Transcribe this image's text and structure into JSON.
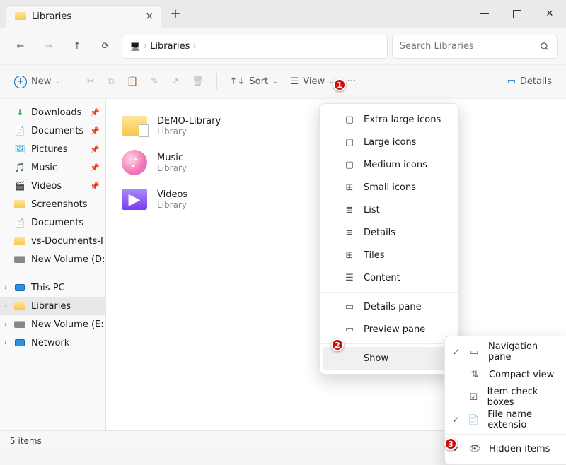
{
  "window": {
    "tab_title": "Libraries",
    "search_placeholder": "Search Libraries"
  },
  "breadcrumb": [
    "Libraries"
  ],
  "toolbar": {
    "new_label": "New",
    "sort_label": "Sort",
    "view_label": "View",
    "details_label": "Details"
  },
  "sidebar": {
    "quick": [
      {
        "label": "Downloads",
        "icon": "download",
        "pin": true
      },
      {
        "label": "Documents",
        "icon": "doc",
        "pin": true
      },
      {
        "label": "Pictures",
        "icon": "pic",
        "pin": true
      },
      {
        "label": "Music",
        "icon": "music",
        "pin": true
      },
      {
        "label": "Videos",
        "icon": "video",
        "pin": true
      },
      {
        "label": "Screenshots",
        "icon": "folder",
        "pin": false
      },
      {
        "label": "Documents",
        "icon": "doc",
        "pin": false
      },
      {
        "label": "vs-Documents-I",
        "icon": "folder",
        "pin": false
      },
      {
        "label": "New Volume (D:",
        "icon": "disk",
        "pin": false
      }
    ],
    "tree": [
      {
        "label": "This PC",
        "icon": "monitor",
        "chev": true,
        "active": false
      },
      {
        "label": "Libraries",
        "icon": "folder",
        "chev": true,
        "active": true
      },
      {
        "label": "New Volume (E:",
        "icon": "disk",
        "chev": true,
        "active": false
      },
      {
        "label": "Network",
        "icon": "monitor",
        "chev": true,
        "active": false
      }
    ]
  },
  "items": [
    {
      "name": "DEMO-Library",
      "sub": "Library",
      "icon": "lib"
    },
    {
      "name": "Music",
      "sub": "Library",
      "icon": "music"
    },
    {
      "name": "Videos",
      "sub": "Library",
      "icon": "video"
    }
  ],
  "view_menu": [
    {
      "label": "Extra large icons",
      "bullet": false,
      "icon": "▢"
    },
    {
      "label": "Large icons",
      "bullet": false,
      "icon": "▢"
    },
    {
      "label": "Medium icons",
      "bullet": false,
      "icon": "▢"
    },
    {
      "label": "Small icons",
      "bullet": false,
      "icon": "⊞"
    },
    {
      "label": "List",
      "bullet": false,
      "icon": "≣"
    },
    {
      "label": "Details",
      "bullet": false,
      "icon": "≡"
    },
    {
      "label": "Tiles",
      "bullet": true,
      "icon": "⊞"
    },
    {
      "label": "Content",
      "bullet": false,
      "icon": "☰"
    }
  ],
  "view_menu_panes": [
    {
      "label": "Details pane",
      "bullet": true,
      "icon": "▭"
    },
    {
      "label": "Preview pane",
      "bullet": false,
      "icon": "▭"
    }
  ],
  "view_menu_show": {
    "label": "Show"
  },
  "show_submenu": [
    {
      "label": "Navigation pane",
      "check": true,
      "icon": "▭"
    },
    {
      "label": "Compact view",
      "check": false,
      "icon": "⇅"
    },
    {
      "label": "Item check boxes",
      "check": false,
      "icon": "☑"
    },
    {
      "label": "File name extensio",
      "check": true,
      "icon": "📄"
    },
    {
      "label": "Hidden items",
      "check": true,
      "icon": "👁"
    }
  ],
  "status": {
    "text": "5 items"
  },
  "annotations": {
    "a1": "1",
    "a2": "2",
    "a3": "3"
  }
}
